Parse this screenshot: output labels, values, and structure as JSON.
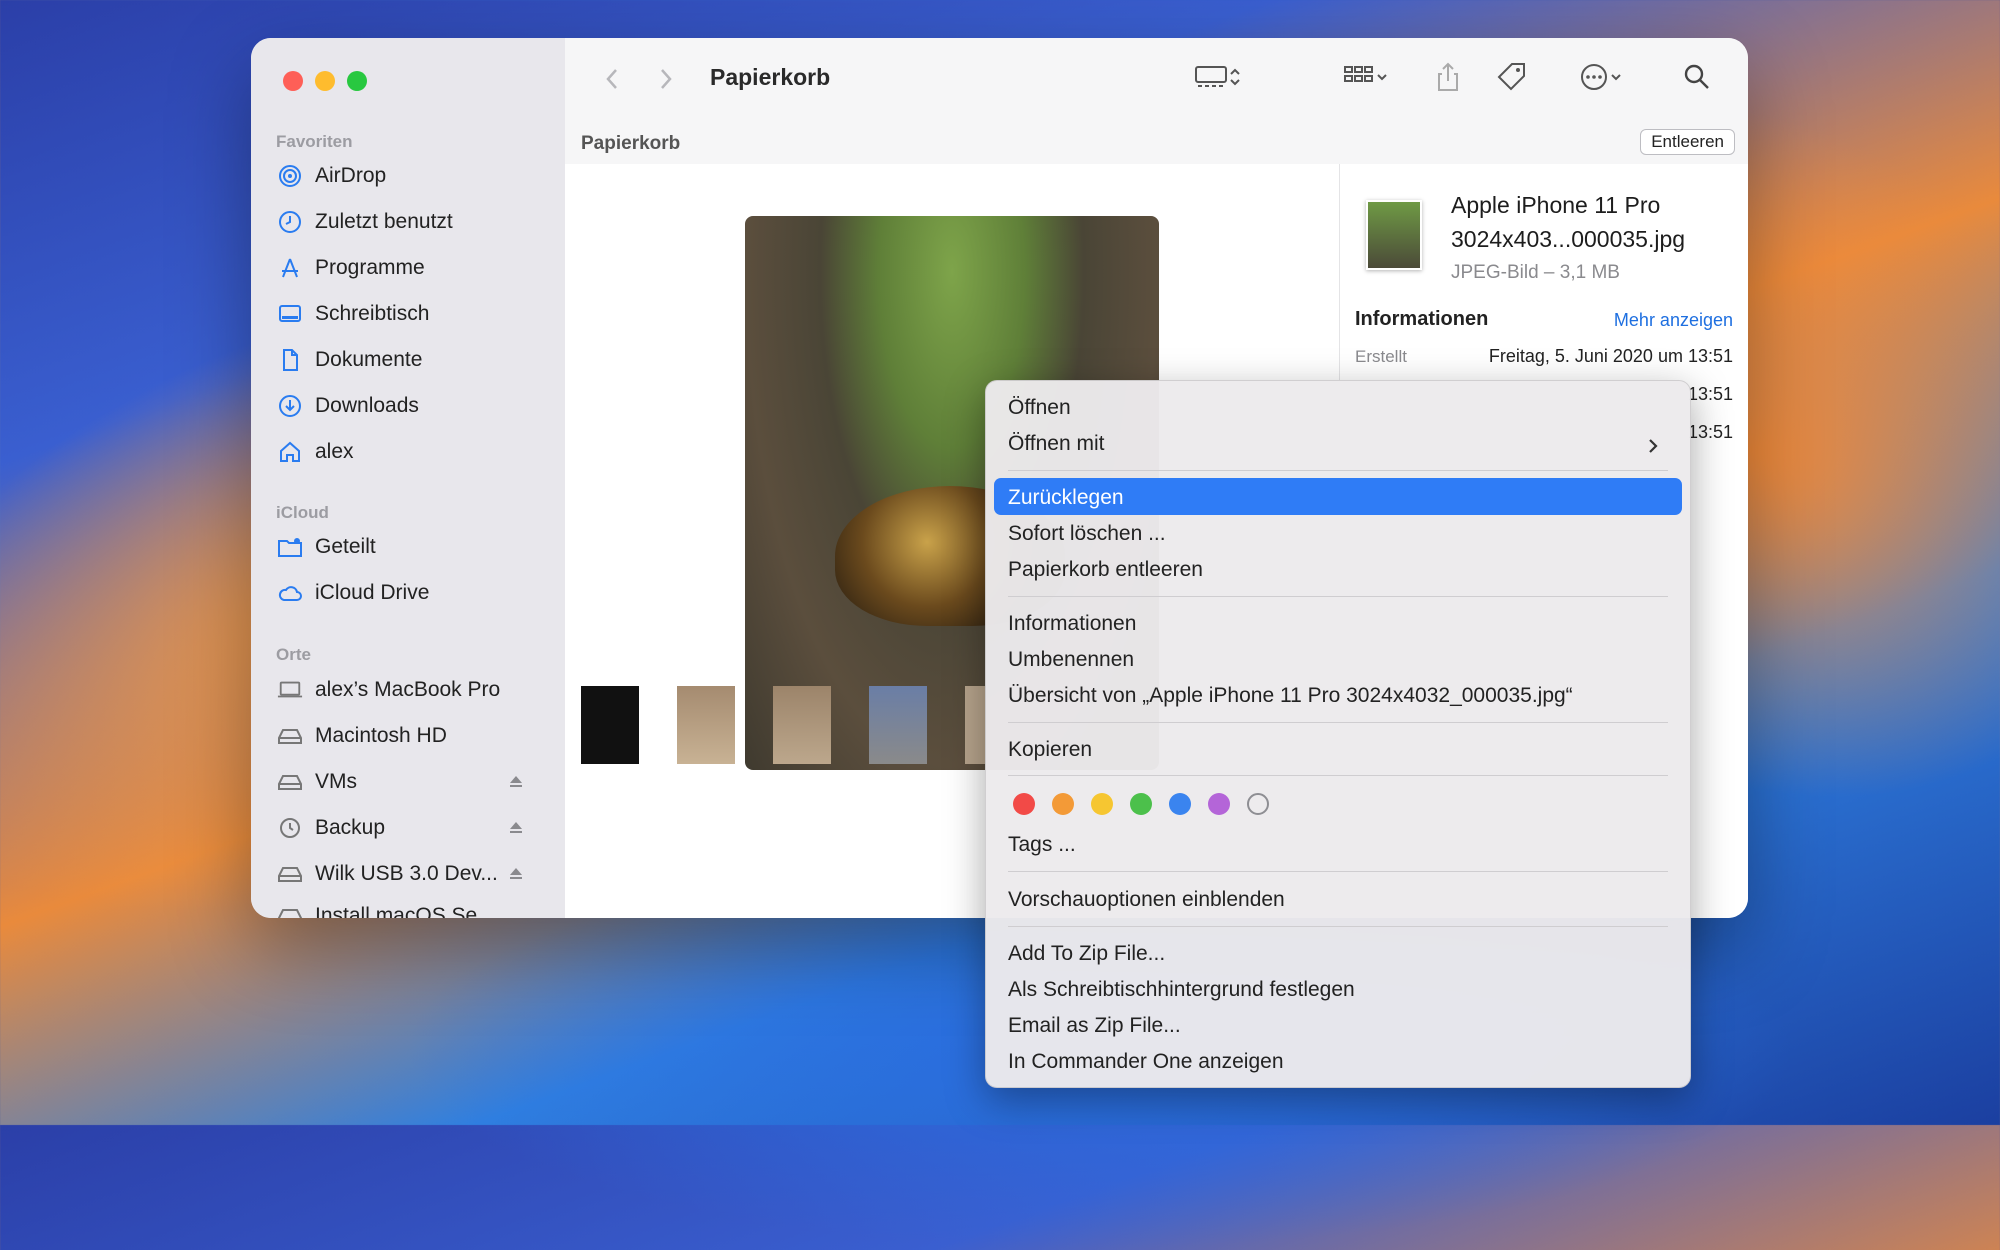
{
  "window": {
    "title": "Papierkorb",
    "path_label": "Papierkorb",
    "empty_button": "Entleeren"
  },
  "sidebar": {
    "sections": [
      {
        "title": "Favoriten",
        "items": [
          {
            "label": "AirDrop",
            "icon": "airdrop-icon"
          },
          {
            "label": "Zuletzt benutzt",
            "icon": "clock-icon"
          },
          {
            "label": "Programme",
            "icon": "apps-icon"
          },
          {
            "label": "Schreibtisch",
            "icon": "desktop-icon"
          },
          {
            "label": "Dokumente",
            "icon": "document-icon"
          },
          {
            "label": "Downloads",
            "icon": "download-icon"
          },
          {
            "label": "alex",
            "icon": "home-icon"
          }
        ]
      },
      {
        "title": "iCloud",
        "items": [
          {
            "label": "Geteilt",
            "icon": "shared-folder-icon"
          },
          {
            "label": "iCloud Drive",
            "icon": "cloud-icon"
          }
        ]
      },
      {
        "title": "Orte",
        "items": [
          {
            "label": "alex’s MacBook Pro",
            "icon": "laptop-icon"
          },
          {
            "label": "Macintosh HD",
            "icon": "disk-icon"
          },
          {
            "label": "VMs",
            "icon": "disk-icon"
          },
          {
            "label": "Backup",
            "icon": "time-machine-icon"
          },
          {
            "label": "Wilk USB 3.0 Dev...",
            "icon": "disk-icon"
          },
          {
            "label": "Install macOS Se...",
            "icon": "disk-icon"
          }
        ]
      }
    ]
  },
  "info": {
    "name": "Apple iPhone 11 Pro 3024x403...000035.jpg",
    "kind": "JPEG-Bild – 3,1 MB",
    "section_title": "Informationen",
    "more_link": "Mehr anzeigen",
    "created_label": "Erstellt",
    "created_value": "Freitag, 5. Juni 2020 um 13:51",
    "row2_value": "13:51",
    "row3_value": "13:51"
  },
  "context_menu": {
    "open": "Öffnen",
    "open_with": "Öffnen mit",
    "put_back": "Zurücklegen",
    "delete_now": "Sofort löschen ...",
    "empty_trash": "Papierkorb entleeren",
    "get_info": "Informationen",
    "rename": "Umbenennen",
    "quick_look": "Übersicht von „Apple iPhone 11 Pro 3024x4032_000035.jpg“",
    "copy": "Kopieren",
    "tags": "Tags ...",
    "show_preview_options": "Vorschauoptionen einblenden",
    "add_zip": "Add To Zip File...",
    "set_wallpaper": "Als Schreibtischhintergrund festlegen",
    "email_zip": "Email as Zip File...",
    "commander_one": "In Commander One anzeigen",
    "tag_colors": [
      "#f24a47",
      "#f39a37",
      "#f6c631",
      "#4cc04b",
      "#3a84ef",
      "#b465d8",
      "none"
    ]
  }
}
